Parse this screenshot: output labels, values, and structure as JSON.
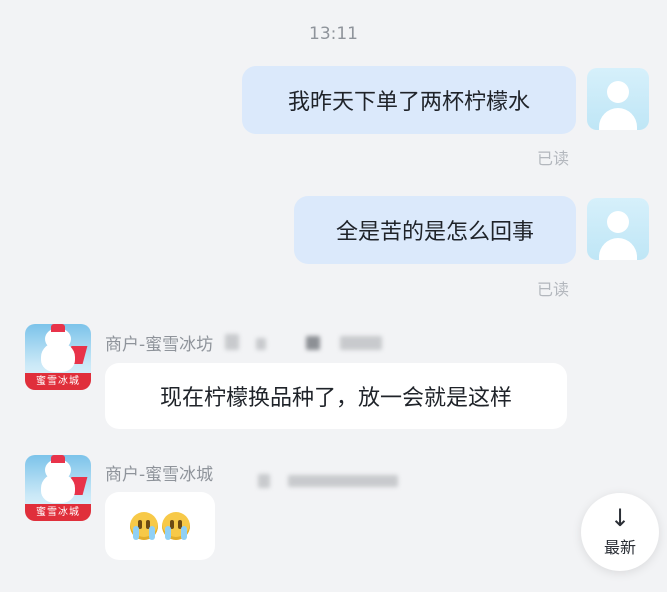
{
  "chat": {
    "timestamp": "13:11",
    "read_label": "已读",
    "outgoing": [
      {
        "text": "我昨天下单了两杯柠檬水"
      },
      {
        "text": "全是苦的是怎么回事"
      }
    ],
    "merchant": {
      "name": "商户-蜜雪冰城",
      "name_partial": "商户-蜜雪冰坊",
      "logo_text": "蜜雪冰城"
    },
    "incoming": [
      {
        "text": "现在柠檬换品种了，放一会就是这样"
      },
      {
        "emoji": "crying-face"
      }
    ],
    "newest_button": {
      "label": "最新",
      "icon": "down-arrow-icon"
    }
  }
}
